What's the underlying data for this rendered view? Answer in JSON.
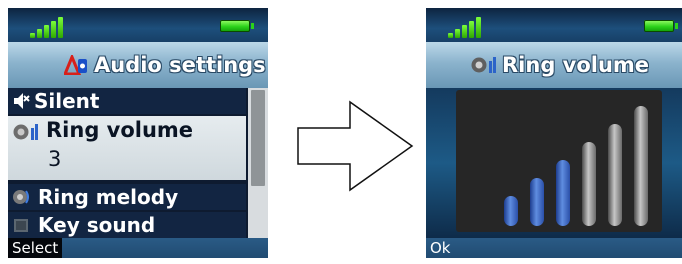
{
  "left_screen": {
    "header_title": "Audio settings",
    "menu_items": [
      {
        "label": "Silent",
        "icon": "speaker-mute-icon"
      },
      {
        "label": "Ring volume",
        "value": "3",
        "icon": "ring-volume-icon"
      },
      {
        "label": "Ring melody",
        "icon": "ring-melody-icon"
      },
      {
        "label": "Key sound",
        "icon": "key-sound-icon"
      }
    ],
    "softkey_label": "Select"
  },
  "right_screen": {
    "header_title": "Ring volume",
    "volume_level": 3,
    "volume_max": 6,
    "softkey_label": "Ok"
  },
  "colors": {
    "status_bar": "#1d4f7c",
    "header": "#8bb3cd",
    "list_background": "#122542",
    "selected_row": "#d8e0e4",
    "volume_on": "#3a66c4",
    "volume_off": "#a8a8a8",
    "signal": "#4fdc1a",
    "battery": "#2bd21a"
  }
}
